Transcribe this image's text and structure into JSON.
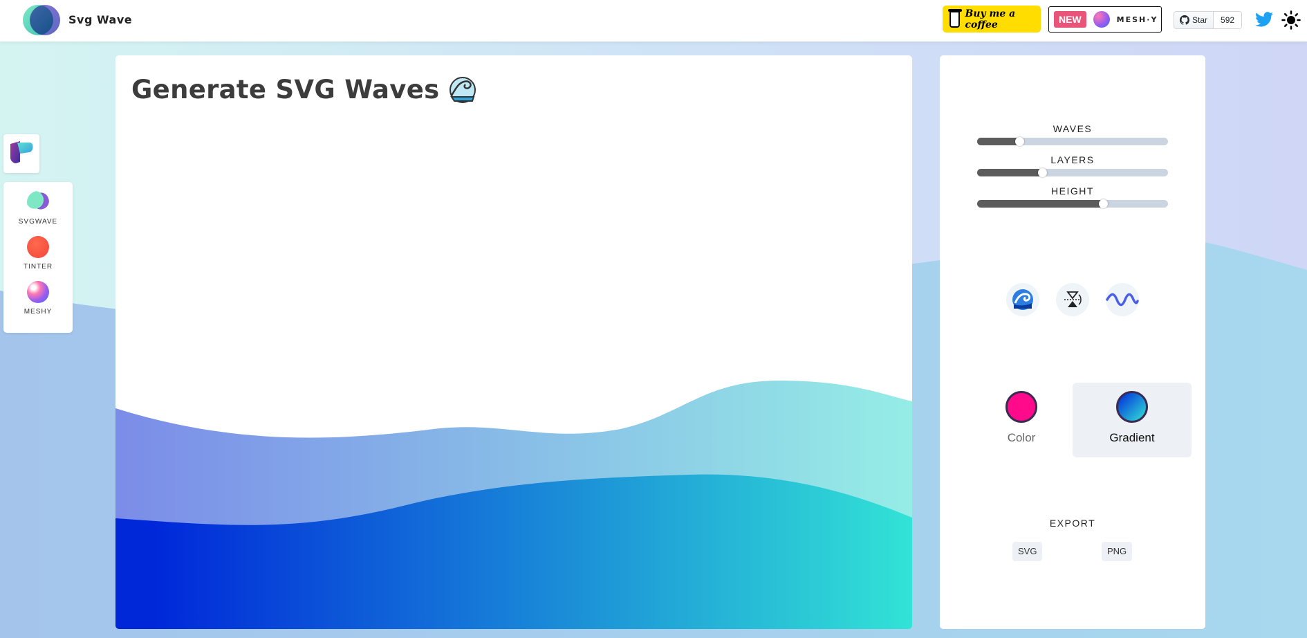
{
  "header": {
    "brand": "Svg Wave",
    "coffee_label": "Buy me a coffee",
    "new_tag": "NEW",
    "meshy_label": "MESH·Y",
    "github_star_label": "Star",
    "github_star_count": "592"
  },
  "sidebar": {
    "apps": [
      {
        "label": "SVGWAVE"
      },
      {
        "label": "TINTER"
      },
      {
        "label": "MESHY"
      }
    ]
  },
  "main": {
    "title": "Generate SVG Waves"
  },
  "controls": {
    "sliders": [
      {
        "label": "WAVES",
        "value": 0.22
      },
      {
        "label": "LAYERS",
        "value": 0.34
      },
      {
        "label": "HEIGHT",
        "value": 0.66
      }
    ],
    "modes": [
      {
        "label": "Color",
        "active": false
      },
      {
        "label": "Gradient",
        "active": true
      }
    ],
    "export_label": "EXPORT",
    "export_buttons": [
      "SVG",
      "PNG"
    ]
  },
  "colors": {
    "solid_swatch": "#ff0a8a",
    "gradient_start": "#0028d9",
    "gradient_end": "#32e3d6",
    "slider_fill": "#5c5c5c",
    "slider_track": "#cbd5e1"
  }
}
